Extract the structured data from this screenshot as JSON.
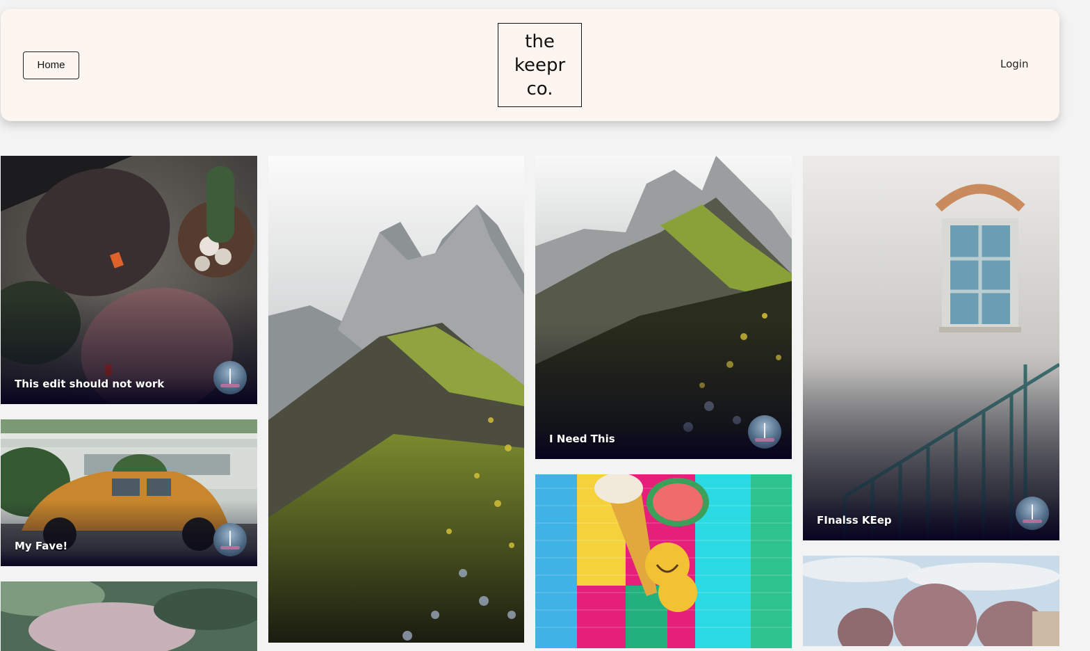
{
  "navbar": {
    "home_label": "Home",
    "logo_line1": "the",
    "logo_line2": "keepr",
    "logo_line3": "co.",
    "login_label": "Login"
  },
  "keeps": [
    {
      "title": "This edit should not work",
      "image": "beanies-and-cactus"
    },
    {
      "title": "My Fave!",
      "image": "orange-beetle-car"
    },
    {
      "title": "",
      "image": "blurry-flower"
    },
    {
      "title": "",
      "image": "mountain-ridge-tall"
    },
    {
      "title": "I Need This",
      "image": "mountain-ridge"
    },
    {
      "title": "",
      "image": "ice-cream-balloons-brick-wall"
    },
    {
      "title": "FInalss KEep",
      "image": "window-and-stairs"
    },
    {
      "title": "",
      "image": "willow-trees-sky"
    }
  ],
  "colors": {
    "navbar_bg": "#fdf5f0",
    "page_bg": "#f3f3f4",
    "card_shade": "#05001e"
  }
}
